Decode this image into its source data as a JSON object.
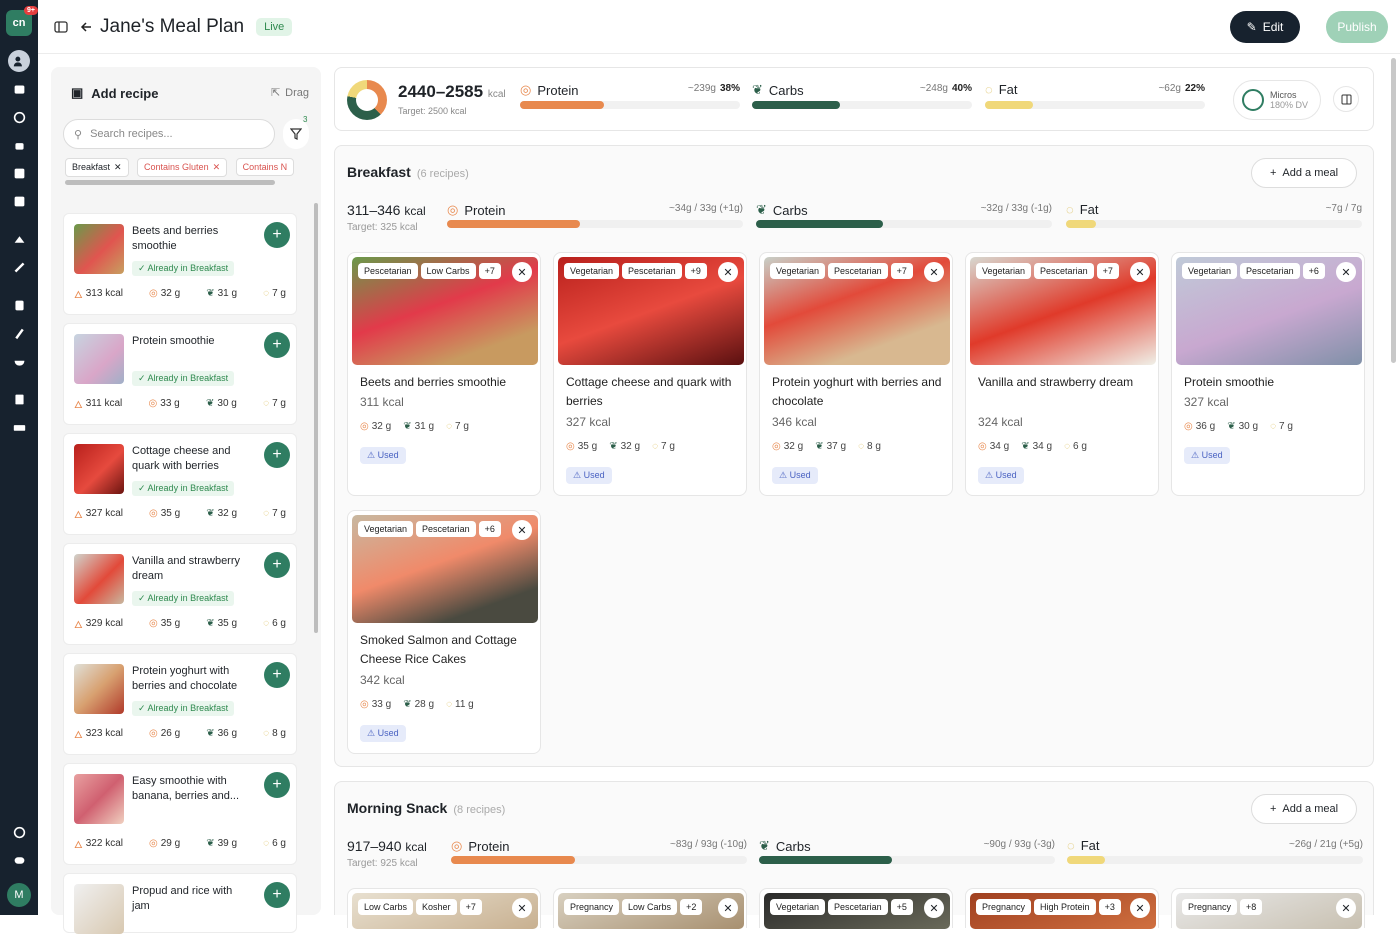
{
  "nav": {
    "badge": "9+",
    "avatar": "M"
  },
  "header": {
    "title": "Jane's Meal Plan",
    "status": "Live",
    "edit": "Edit",
    "publish": "Publish"
  },
  "sidebar": {
    "title": "Add recipe",
    "drag": "Drag",
    "search_placeholder": "Search recipes...",
    "filter_count": "3",
    "chips": [
      "Breakfast",
      "Contains Gluten",
      "Contains N"
    ],
    "recipes": [
      {
        "name": "Beets and berries smoothie",
        "tag": "Already in Breakfast",
        "kcal": "313 kcal",
        "p": "32 g",
        "c": "31 g",
        "f": "7 g"
      },
      {
        "name": "Protein smoothie",
        "tag": "Already in Breakfast",
        "kcal": "311 kcal",
        "p": "33 g",
        "c": "30 g",
        "f": "7 g"
      },
      {
        "name": "Cottage cheese and quark with berries",
        "tag": "Already in Breakfast",
        "kcal": "327 kcal",
        "p": "35 g",
        "c": "32 g",
        "f": "7 g"
      },
      {
        "name": "Vanilla and strawberry dream",
        "tag": "Already in Breakfast",
        "kcal": "329 kcal",
        "p": "35 g",
        "c": "35 g",
        "f": "6 g"
      },
      {
        "name": "Protein yoghurt with berries and chocolate",
        "tag": "Already in Breakfast",
        "kcal": "323 kcal",
        "p": "26 g",
        "c": "36 g",
        "f": "8 g"
      },
      {
        "name": "Easy smoothie with banana, berries and...",
        "tag": "",
        "kcal": "322 kcal",
        "p": "29 g",
        "c": "39 g",
        "f": "6 g"
      },
      {
        "name": "Propud and rice with jam",
        "tag": "",
        "kcal": "",
        "p": "",
        "c": "",
        "f": ""
      }
    ]
  },
  "summary": {
    "kcal": "2440–2585",
    "unit": "kcal",
    "target": "Target: 2500 kcal",
    "protein": {
      "label": "Protein",
      "amt": "~239g",
      "pct": "38%",
      "fill": 0.38
    },
    "carbs": {
      "label": "Carbs",
      "amt": "~248g",
      "pct": "40%",
      "fill": 0.4
    },
    "fat": {
      "label": "Fat",
      "amt": "~62g",
      "pct": "22%",
      "fill": 0.22
    },
    "micros": "Micros",
    "micros_dv": "180% DV"
  },
  "breakfast": {
    "title": "Breakfast",
    "count": "(6 recipes)",
    "add": "Add a meal",
    "kcal": "311–346",
    "unit": "kcal",
    "target": "Target: 325 kcal",
    "protein": {
      "label": "Protein",
      "val": "~34g  /  33g  (+1g)",
      "fill": 0.45
    },
    "carbs": {
      "label": "Carbs",
      "val": "~32g  /  33g  (-1g)",
      "fill": 0.43
    },
    "fat": {
      "label": "Fat",
      "val": "~7g  /  7g",
      "fill": 0.1
    },
    "meals": [
      {
        "tags": [
          "Pescetarian",
          "Low Carbs",
          "+7"
        ],
        "name": "Beets and berries smoothie",
        "kcal": "311 kcal",
        "p": "32 g",
        "c": "31 g",
        "f": "7 g",
        "used": "Used"
      },
      {
        "tags": [
          "Vegetarian",
          "Pescetarian",
          "+9"
        ],
        "name": "Cottage cheese and quark with berries",
        "kcal": "327 kcal",
        "p": "35 g",
        "c": "32 g",
        "f": "7 g",
        "used": "Used"
      },
      {
        "tags": [
          "Vegetarian",
          "Pescetarian",
          "+7"
        ],
        "name": "Protein yoghurt with berries and chocolate",
        "kcal": "346 kcal",
        "p": "32 g",
        "c": "37 g",
        "f": "8 g",
        "used": "Used"
      },
      {
        "tags": [
          "Vegetarian",
          "Pescetarian",
          "+7"
        ],
        "name": "Vanilla and strawberry dream",
        "kcal": "324 kcal",
        "p": "34 g",
        "c": "34 g",
        "f": "6 g",
        "used": "Used"
      },
      {
        "tags": [
          "Vegetarian",
          "Pescetarian",
          "+6"
        ],
        "name": "Protein smoothie",
        "kcal": "327 kcal",
        "p": "36 g",
        "c": "30 g",
        "f": "7 g",
        "used": "Used"
      },
      {
        "tags": [
          "Vegetarian",
          "Pescetarian",
          "+6"
        ],
        "name": "Smoked Salmon and Cottage Cheese Rice Cakes",
        "kcal": "342 kcal",
        "p": "33 g",
        "c": "28 g",
        "f": "11 g",
        "used": "Used"
      }
    ]
  },
  "snack": {
    "title": "Morning Snack",
    "count": "(8 recipes)",
    "add": "Add a meal",
    "kcal": "917–940",
    "unit": "kcal",
    "target": "Target: 925 kcal",
    "protein": {
      "label": "Protein",
      "val": "~83g  /  93g  (-10g)",
      "fill": 0.42
    },
    "carbs": {
      "label": "Carbs",
      "val": "~90g  /  93g  (-3g)",
      "fill": 0.45
    },
    "fat": {
      "label": "Fat",
      "val": "~26g  /  21g  (+5g)",
      "fill": 0.13
    },
    "tagsets": [
      [
        "Low Carbs",
        "Kosher",
        "+7"
      ],
      [
        "Pregnancy",
        "Low Carbs",
        "+2"
      ],
      [
        "Vegetarian",
        "Pescetarian",
        "+5"
      ],
      [
        "Pregnancy",
        "High Protein",
        "+3"
      ],
      [
        "Pregnancy",
        "+8"
      ]
    ]
  },
  "colors": {
    "protein": "#e8894e",
    "carbs": "#2c5f4a",
    "fat": "#f0d87a",
    "brand": "#2f7d62"
  }
}
